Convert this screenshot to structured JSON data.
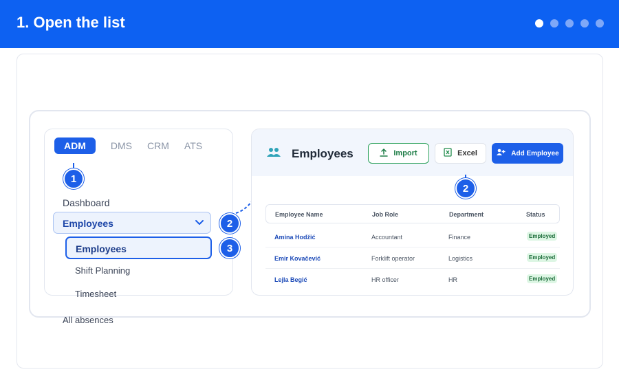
{
  "header": {
    "title": "1. Open the list",
    "dots": 5,
    "active_dot": 0
  },
  "sidebar": {
    "tabs": [
      "ADM",
      "DMS",
      "CRM",
      "ATS"
    ],
    "active_tab": "ADM",
    "dashboard": "Dashboard",
    "group": "Employees",
    "subitem_active": "Employees",
    "shift_planning": "Shift Planning",
    "timesheet": "Timesheet",
    "all_absences": "All absences"
  },
  "badges": {
    "b1": "1",
    "b2a": "2",
    "b2b": "2",
    "b3": "3"
  },
  "panel": {
    "title": "Employees",
    "import_label": "Import",
    "excel_label": "Excel",
    "add_label": "Add Employee",
    "columns": [
      "Employee Name",
      "Job Role",
      "Department",
      "Status"
    ],
    "rows": [
      {
        "name": "Amina Hodžić",
        "role": "Accountant",
        "department": "Finance",
        "status": "Employed"
      },
      {
        "name": "Emir Kovačević",
        "role": "Forklift operator",
        "department": "Logistics",
        "status": "Employed"
      },
      {
        "name": "Lejla Begić",
        "role": "HR officer",
        "department": "HR",
        "status": "Employed"
      }
    ]
  },
  "colors": {
    "brand": "#0d61f2",
    "accent": "#1d5fe8",
    "import_green": "#2aa05a",
    "status_bg": "#ddf6e4"
  }
}
